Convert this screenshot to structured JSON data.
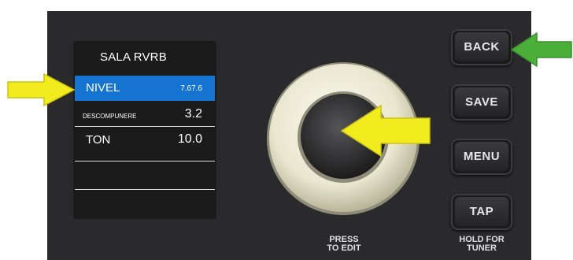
{
  "screen": {
    "title": "SALA RVRB",
    "rows": [
      {
        "label": "NIVEL",
        "value": "7.67.6"
      },
      {
        "label": "DESCOMPUNERE",
        "value": "3.2"
      },
      {
        "label": "TON",
        "value": "10.0"
      }
    ]
  },
  "buttons": {
    "back": "BACK",
    "save": "SAVE",
    "menu": "MENU",
    "tap": "TAP"
  },
  "captions": {
    "press_line1": "PRESS",
    "press_line2": "TO EDIT",
    "hold_line1": "HOLD FOR",
    "hold_line2": "TUNER"
  },
  "colors": {
    "panel": "#2a2a2c",
    "selected_row": "#1574d1",
    "yellow_arrow": "#f2ec1f",
    "green_arrow": "#4caf3a"
  }
}
